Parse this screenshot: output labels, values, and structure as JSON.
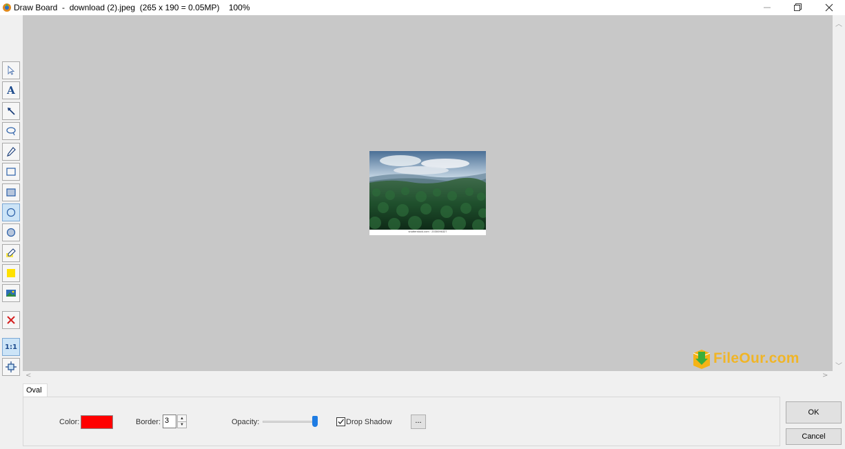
{
  "window": {
    "title": "Draw Board  -  download (2).jpeg  (265 x 190 = 0.05MP)    100%"
  },
  "toolbar": {
    "tools": [
      {
        "name": "select",
        "icon": "cursor-icon",
        "active": false
      },
      {
        "name": "text",
        "icon": "text-icon",
        "label": "A",
        "active": false
      },
      {
        "name": "arrow",
        "icon": "arrow-icon",
        "active": false
      },
      {
        "name": "lasso",
        "icon": "lasso-icon",
        "active": false
      },
      {
        "name": "pencil",
        "icon": "pencil-icon",
        "active": false
      },
      {
        "name": "rectangle",
        "icon": "rectangle-outline-icon",
        "active": false
      },
      {
        "name": "filled-rectangle",
        "icon": "rectangle-filled-icon",
        "active": false
      },
      {
        "name": "oval",
        "icon": "oval-outline-icon",
        "active": true
      },
      {
        "name": "filled-oval",
        "icon": "oval-filled-icon",
        "active": false
      },
      {
        "name": "highlighter",
        "icon": "highlighter-icon",
        "active": false
      },
      {
        "name": "yellow-fill",
        "icon": "yellow-square-icon",
        "active": false
      },
      {
        "name": "image",
        "icon": "image-icon",
        "active": false
      },
      {
        "name": "delete",
        "icon": "delete-x-icon",
        "active": false
      },
      {
        "name": "actual-size",
        "icon": "actual-size-icon",
        "label": "1:1",
        "active": true
      },
      {
        "name": "fit-window",
        "icon": "fit-window-icon",
        "active": false
      }
    ]
  },
  "canvas": {
    "photo_caption": "shutterstock.com · 2030096327"
  },
  "watermark": {
    "text": "FileOur.com"
  },
  "properties": {
    "tab_label": "Oval",
    "color_label": "Color:",
    "color_value": "#ff0000",
    "border_label": "Border:",
    "border_value": "3",
    "opacity_label": "Opacity:",
    "opacity_percent": 100,
    "drop_shadow_label": "Drop Shadow",
    "drop_shadow_checked": true,
    "more_button_label": "..."
  },
  "buttons": {
    "ok_label": "OK",
    "cancel_label": "Cancel"
  }
}
